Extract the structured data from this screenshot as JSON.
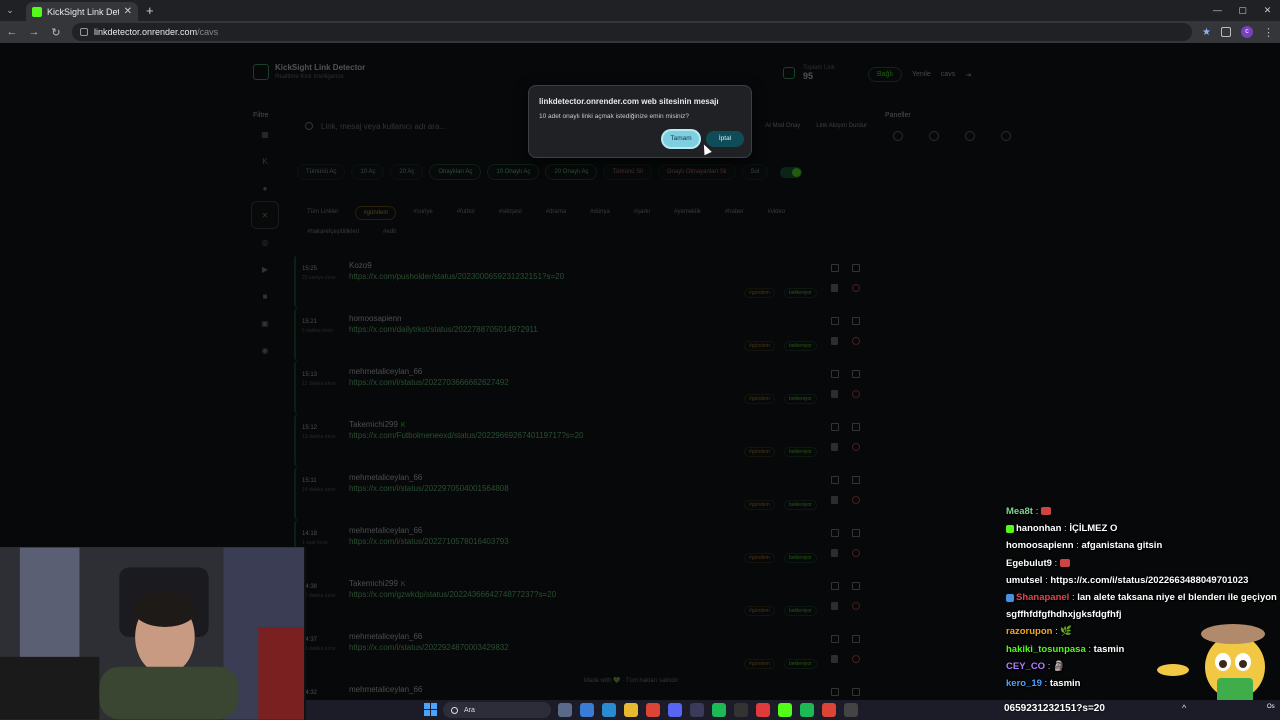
{
  "browser": {
    "tab_title": "KickSight Link Detector",
    "url_host": "linkdetector.onrender.com",
    "url_path": "/cavs"
  },
  "app": {
    "brand_name": "KickSight Link Detector",
    "brand_sub": "Realtime Kick Intelligence",
    "stat_label": "Toplam Link",
    "stat_value": "95",
    "status_pill": "Bağlı",
    "refresh_label": "Yenile",
    "user_label": "cavs",
    "filters_title": "Filtre",
    "panels_title": "Paneller",
    "search_placeholder": "Link, mesaj veya kullanıcı adı ara...",
    "opt_ai": "AI Mod Onay",
    "opt_stop": "Link Akışını Durdur",
    "actions": [
      {
        "label": "Tümünü Aç",
        "style": ""
      },
      {
        "label": "10 Aç",
        "style": ""
      },
      {
        "label": "20 Aç",
        "style": ""
      },
      {
        "label": "Onaylıları Aç",
        "style": "green"
      },
      {
        "label": "10 Onaylı Aç",
        "style": "green"
      },
      {
        "label": "20 Onaylı Aç",
        "style": "green"
      },
      {
        "label": "Tümünü Sil",
        "style": "red"
      },
      {
        "label": "Onaylı Olmayanları Sil",
        "style": "red"
      },
      {
        "label": "Sol",
        "style": ""
      }
    ],
    "tags": [
      {
        "label": "Tüm Linkler",
        "sel": false
      },
      {
        "label": "#gündem",
        "sel": true
      },
      {
        "label": "#suriye",
        "sel": false
      },
      {
        "label": "#futbol",
        "sel": false
      },
      {
        "label": "#siktşesi",
        "sel": false
      },
      {
        "label": "#drama",
        "sel": false
      },
      {
        "label": "#dünya",
        "sel": false
      },
      {
        "label": "#şarkı",
        "sel": false
      },
      {
        "label": "#yemeklik",
        "sel": false
      },
      {
        "label": "#haber",
        "sel": false
      },
      {
        "label": "#video",
        "sel": false
      },
      {
        "label": "#hakaretçeşitlilikleri",
        "sel": false
      },
      {
        "label": "#edit",
        "sel": false
      }
    ],
    "feed": [
      {
        "time": "15:25",
        "ago": "20 saniye önce",
        "user": "Kozo9",
        "verified": false,
        "url": "https://x.com/pusholder/status/2023000659231232151?s=20",
        "tag": "#gündem",
        "status": "bekleniyor"
      },
      {
        "time": "15:21",
        "ago": "5 dakika önce",
        "user": "homoosapienn",
        "verified": false,
        "url": "https://x.com/dailytrkst/status/2022788705014972911",
        "tag": "#gündem",
        "status": "bekleniyor"
      },
      {
        "time": "15:13",
        "ago": "12 dakika önce",
        "user": "mehmetaliceylan_66",
        "verified": false,
        "url": "https://x.com/i/status/2022703666662627492",
        "tag": "#gündem",
        "status": "bekleniyor"
      },
      {
        "time": "15:12",
        "ago": "13 dakika önce",
        "user": "Takemichi299",
        "verified": true,
        "url": "https://x.com/Futbolmeneexd/status/2022966926740119717?s=20",
        "tag": "#gündem",
        "status": "bekleniyor"
      },
      {
        "time": "15:11",
        "ago": "14 dakika önce",
        "user": "mehmetaliceylan_66",
        "verified": false,
        "url": "https://x.com/i/status/2022970504001564808",
        "tag": "#gündem",
        "status": "bekleniyor"
      },
      {
        "time": "14:18",
        "ago": "1 saat önce",
        "user": "mehmetaliceylan_66",
        "verified": false,
        "url": "https://x.com/i/status/2022710578016403793",
        "tag": "#gündem",
        "status": "bekleniyor"
      },
      {
        "time": "14:38",
        "ago": "47 dakika önce",
        "user": "Takemichi299",
        "verified": true,
        "url": "https://x.com/gzwkdp/status/2022436664274877237?s=20",
        "tag": "#gündem",
        "status": "bekleniyor"
      },
      {
        "time": "14:37",
        "ago": "48 dakika önce",
        "user": "mehmetaliceylan_66",
        "verified": false,
        "url": "https://x.com/i/status/2022924870003429832",
        "tag": "#gündem",
        "status": "bekleniyor"
      },
      {
        "time": "14:32",
        "ago": "",
        "user": "mehmetaliceylan_66",
        "verified": false,
        "url": "",
        "tag": "",
        "status": ""
      }
    ],
    "footer_note": "Made with 💚 · Tüm hakları saklıdır"
  },
  "dialog": {
    "title": "linkdetector.onrender.com web sitesinin mesajı",
    "message": "10 adet onaylı linki açmak istediğinize emin misiniz?",
    "ok_label": "Tamam",
    "cancel_label": "İptal"
  },
  "chat": [
    {
      "user": "Mea8t",
      "color": "#7fd48f",
      "badge": "",
      "text": "",
      "emote": true
    },
    {
      "user": "hanonhan",
      "color": "#ffffff",
      "badge": "b1",
      "text": "İÇİLMEZ O",
      "emote": false
    },
    {
      "user": "homoosapienn",
      "color": "#ffffff",
      "badge": "",
      "text": "afganistana gitsin",
      "emote": false
    },
    {
      "user": "Egebulut9",
      "color": "#ffffff",
      "badge": "",
      "text": "",
      "emote": true
    },
    {
      "user": "umutsel",
      "color": "#ffffff",
      "badge": "",
      "text": "https://x.com/i/status/2022663488049701023",
      "emote": false
    },
    {
      "user": "Shanapanel",
      "color": "#e0454f",
      "badge": "b2",
      "text": "lan alete taksana niye el blenderı ile geçiyon",
      "emote": false
    },
    {
      "user": "",
      "color": "#ffffff",
      "badge": "",
      "text": "sgffhfdfgfhdhxjgksfdgfhfj",
      "emote": false
    },
    {
      "user": "razorupon",
      "color": "#f5a623",
      "badge": "",
      "text": "🌿",
      "emote": false
    },
    {
      "user": "hakiki_tosunpasa",
      "color": "#53fc18",
      "badge": "",
      "text": "tasmin",
      "emote": false
    },
    {
      "user": "CEY_CO",
      "color": "#b07fff",
      "badge": "",
      "text": "🗿",
      "emote": false
    },
    {
      "user": "kero_19",
      "color": "#4aa3ff",
      "badge": "",
      "text": "tasmin",
      "emote": false
    }
  ],
  "taskbar": {
    "search_label": "Ara",
    "ticker": "0659231232151?s=20",
    "os_label": "Os"
  },
  "colors": {
    "kick_green": "#53fc18",
    "page_bg": "#060809",
    "dialog_bg": "#202124"
  }
}
